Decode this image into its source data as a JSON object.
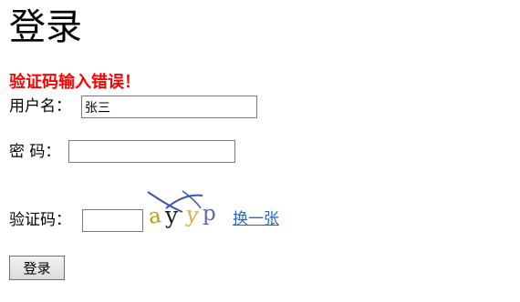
{
  "page": {
    "title": "登录",
    "error_message": "验证码输入错误！"
  },
  "form": {
    "username_label": "用户名：",
    "username_value": "张三",
    "password_label": "密 码：",
    "password_value": "",
    "captcha_label": "验证码：",
    "captcha_value": "",
    "captcha_image_text": "ayyp",
    "refresh_link": "换一张",
    "submit_label": "登录"
  },
  "colors": {
    "error": "#ff0000",
    "link": "#2a66c8"
  }
}
